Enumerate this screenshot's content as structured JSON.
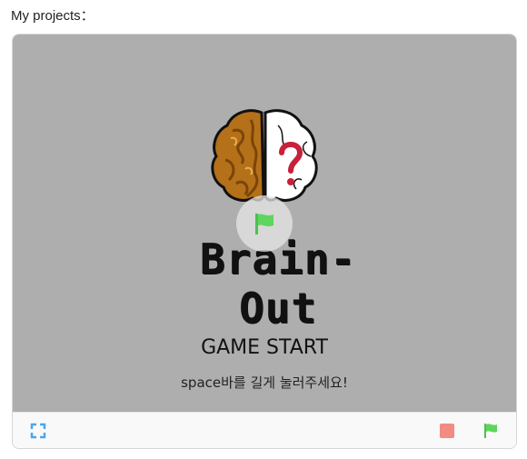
{
  "page": {
    "heading": "My projects："
  },
  "stage": {
    "logo_text": "Brain-Out",
    "title": "GAME START",
    "hint": "space바를 길게 눌러주세요!"
  },
  "icons": {
    "overlay": "green-flag-icon",
    "fullscreen": "fullscreen-icon",
    "stop": "stop-icon",
    "go": "green-flag-icon",
    "logo_art": "brain-icon"
  },
  "colors": {
    "stage_bg": "#aeaeae",
    "flag_green": "#5cd65c",
    "stop_red": "#f28b82",
    "fullscreen_blue": "#4da6e8",
    "question_red": "#c8203a",
    "brain_brown": "#b5701a"
  }
}
